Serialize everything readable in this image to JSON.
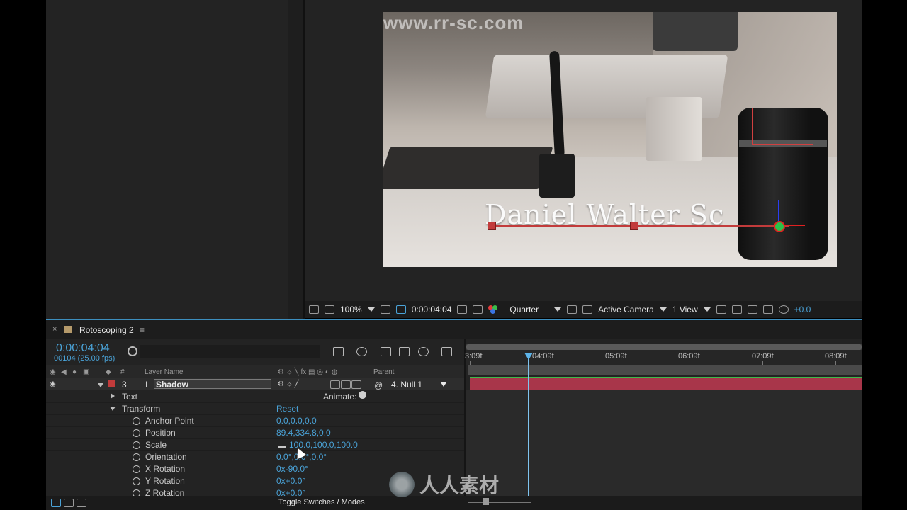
{
  "watermarks": {
    "top_url": "www.rr-sc.com",
    "bottom_brand": "人人素材"
  },
  "footage": {
    "title_text": "Daniel Walter Sc"
  },
  "viewer_toolbar": {
    "magnification": "100%",
    "timecode": "0:00:04:04",
    "resolution": "Quarter",
    "camera": "Active Camera",
    "views": "1 View",
    "exposure": "+0.0"
  },
  "composition": {
    "tab_title": "Rotoscoping 2",
    "tab_close": "×",
    "tab_menu": "≡"
  },
  "timeline": {
    "timecode": "0:00:04:04",
    "frames": "00104 (25.00 fps)",
    "columns": {
      "label": "#",
      "layer_name": "Layer Name",
      "parent": "Parent"
    },
    "ruler": [
      "3:09f",
      "04:09f",
      "05:09f",
      "06:09f",
      "07:09f",
      "08:09f"
    ],
    "toggle_label": "Toggle Switches / Modes"
  },
  "layer": {
    "number": "3",
    "name": "Shadow",
    "parent": "4. Null 1",
    "color": "#c23b3b"
  },
  "properties": {
    "text_label": "Text",
    "animate_label": "Animate:",
    "transform_label": "Transform",
    "reset_label": "Reset",
    "items": [
      {
        "label": "Anchor Point",
        "value": "0.0,0.0,0.0"
      },
      {
        "label": "Position",
        "value": "89.4,334.8,0.0"
      },
      {
        "label": "Scale",
        "value": "100.0,100.0,100.0"
      },
      {
        "label": "Orientation",
        "value": "0.0°,0.0°,0.0°"
      },
      {
        "label": "X Rotation",
        "value": "0x-90.0°"
      },
      {
        "label": "Y Rotation",
        "value": "0x+0.0°"
      },
      {
        "label": "Z Rotation",
        "value": "0x+0.0°"
      }
    ]
  }
}
